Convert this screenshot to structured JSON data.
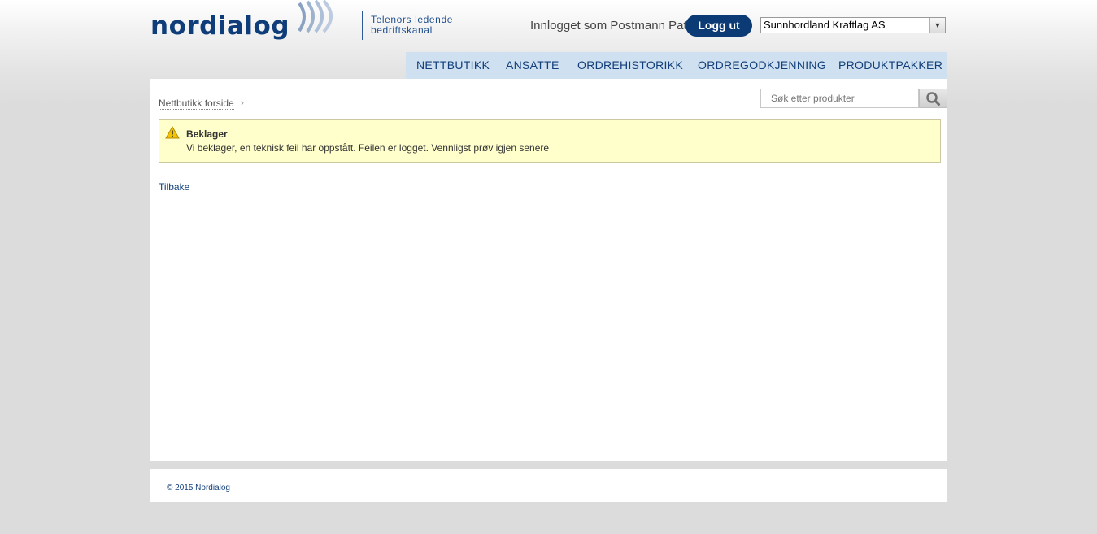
{
  "header": {
    "logo_text": "nordialog",
    "tagline_line1": "Telenors ledende",
    "tagline_line2": "bedriftskanal",
    "login_status": "Innlogget som Postmann Pat",
    "logout_label": "Logg ut",
    "company_selected": "Sunnhordland Kraftlag AS"
  },
  "nav": {
    "items": [
      {
        "label": "NETTBUTIKK"
      },
      {
        "label": "ANSATTE"
      },
      {
        "label": "ORDREHISTORIKK"
      },
      {
        "label": "ORDREGODKJENNING"
      },
      {
        "label": "PRODUKTPAKKER"
      }
    ]
  },
  "main": {
    "breadcrumb": "Nettbutikk forside",
    "search_placeholder": "Søk etter produkter",
    "alert": {
      "title": "Beklager",
      "message": "Vi beklager, en teknisk feil har oppstått. Feilen er logget. Vennligst prøv igjen senere"
    },
    "back_label": "Tilbake"
  },
  "footer": {
    "copyright": "© 2015 Nordialog"
  },
  "colors": {
    "brand_blue": "#0f3d7a",
    "nav_bg": "#cfe0f0",
    "alert_bg": "#ffffcc",
    "page_bg": "#dcdcdc"
  },
  "icons": {
    "logo_mark": "signal-waves-icon",
    "search": "search-icon",
    "warning": "warning-icon",
    "dropdown": "chevron-down-icon",
    "breadcrumb_sep": "chevron-right-icon"
  }
}
